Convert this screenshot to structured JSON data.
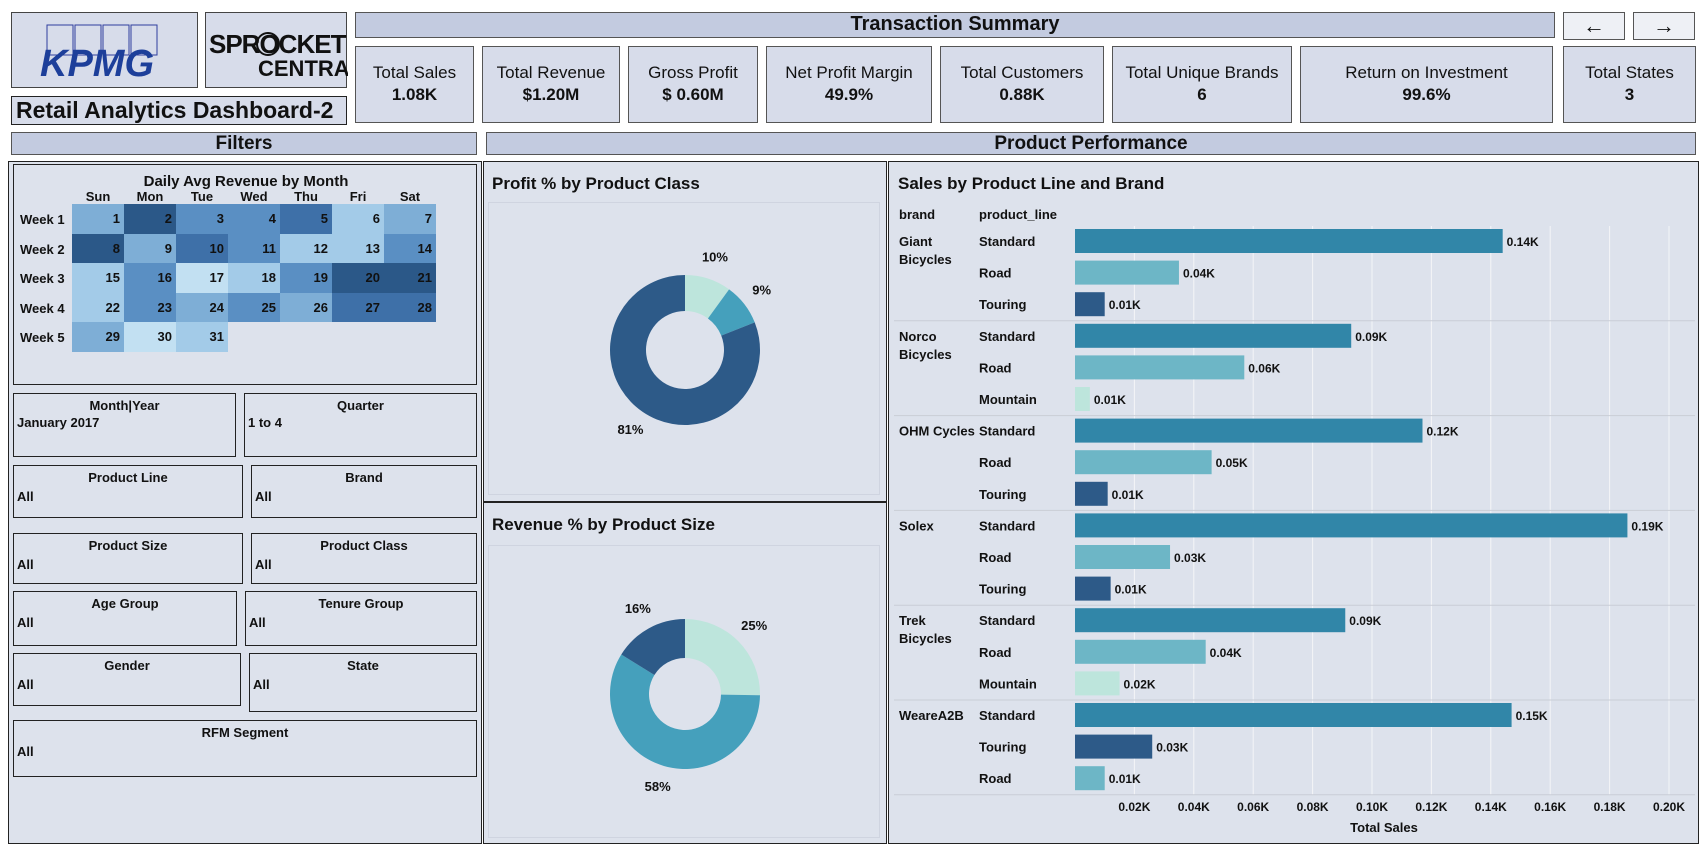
{
  "logos": {
    "kpmg": "KPMG",
    "sprocket_line1": "SPROCKET",
    "sprocket_line2": "CENTRAL"
  },
  "dashboard_title": "Retail Analytics Dashboard-2",
  "transaction_summary_title": "Transaction Summary",
  "nav": {
    "back": "←",
    "forward": "→"
  },
  "kpis": [
    {
      "label": "Total Sales",
      "value": "1.08K"
    },
    {
      "label": "Total Revenue",
      "value": "$1.20M"
    },
    {
      "label": "Gross Profit",
      "value": "$ 0.60M"
    },
    {
      "label": "Net Profit Margin",
      "value": "49.9%"
    },
    {
      "label": "Total Customers",
      "value": "0.88K"
    },
    {
      "label": "Total Unique Brands",
      "value": "6"
    },
    {
      "label": "Return on Investment",
      "value": "99.6%"
    },
    {
      "label": "Total States",
      "value": "3"
    }
  ],
  "filters_header": "Filters",
  "product_performance_header": "Product Performance",
  "calendar": {
    "title": "Daily Avg Revenue by Month",
    "days": [
      "Sun",
      "Mon",
      "Tue",
      "Wed",
      "Thu",
      "Fri",
      "Sat"
    ],
    "weeks": [
      "Week 1",
      "Week 2",
      "Week 3",
      "Week 4",
      "Week 5"
    ],
    "cells": [
      [
        "1",
        "2",
        "3",
        "4",
        "5",
        "6",
        "7"
      ],
      [
        "8",
        "9",
        "10",
        "11",
        "12",
        "13",
        "14"
      ],
      [
        "15",
        "16",
        "17",
        "18",
        "19",
        "20",
        "21"
      ],
      [
        "22",
        "23",
        "24",
        "25",
        "26",
        "27",
        "28"
      ],
      [
        "29",
        "30",
        "31",
        "",
        "",
        "",
        ""
      ]
    ],
    "intensity": [
      [
        2,
        5,
        3,
        3,
        4,
        1,
        2
      ],
      [
        5,
        2,
        4,
        3,
        1,
        1,
        3
      ],
      [
        1,
        3,
        0,
        1,
        3,
        5,
        5
      ],
      [
        1,
        3,
        2,
        3,
        2,
        4,
        4
      ],
      [
        2,
        0,
        1,
        null,
        null,
        null,
        null
      ]
    ],
    "palette": [
      "#c2e0f2",
      "#a3cbe8",
      "#7eaed6",
      "#5a8fc3",
      "#3e70a8",
      "#2b5888"
    ]
  },
  "filters": {
    "month_year": {
      "label": "Month|Year",
      "value": "January 2017"
    },
    "quarter": {
      "label": "Quarter",
      "value": "1 to 4"
    },
    "product_line": {
      "label": "Product Line",
      "value": "All"
    },
    "brand": {
      "label": "Brand",
      "value": "All"
    },
    "product_size": {
      "label": "Product Size",
      "value": "All"
    },
    "product_class": {
      "label": "Product Class",
      "value": "All"
    },
    "age_group": {
      "label": "Age Group",
      "value": "All"
    },
    "tenure_group": {
      "label": "Tenure Group",
      "value": "All"
    },
    "gender": {
      "label": "Gender",
      "value": "All"
    },
    "state": {
      "label": "State",
      "value": "All"
    },
    "rfm_segment": {
      "label": "RFM Segment",
      "value": "All"
    }
  },
  "chart_data": [
    {
      "type": "pie",
      "title": "Profit % by Product Class",
      "slices": [
        {
          "value": 10,
          "label": "10%",
          "color": "#bde5dc"
        },
        {
          "value": 9,
          "label": "9%",
          "color": "#45a0bc"
        },
        {
          "value": 81,
          "label": "81%",
          "color": "#2d5a88"
        }
      ],
      "donut": true
    },
    {
      "type": "pie",
      "title": "Revenue % by Product Size",
      "slices": [
        {
          "value": 25,
          "label": "25%",
          "color": "#bde5dc"
        },
        {
          "value": 58,
          "label": "58%",
          "color": "#45a0bc"
        },
        {
          "value": 16,
          "label": "16%",
          "color": "#2d5a88"
        }
      ],
      "donut": true
    },
    {
      "type": "bar",
      "orientation": "horizontal",
      "title": "Sales by Product Line and Brand",
      "column_headers": [
        "brand",
        "product_line"
      ],
      "xlabel": "Total Sales",
      "xlim": [
        0,
        0.2
      ],
      "x_ticks": [
        "0.02K",
        "0.04K",
        "0.06K",
        "0.08K",
        "0.10K",
        "0.12K",
        "0.14K",
        "0.16K",
        "0.18K",
        "0.20K"
      ],
      "groups": [
        {
          "brand": [
            "Giant",
            "Bicycles"
          ],
          "rows": [
            {
              "line": "Standard",
              "value": 0.144,
              "label": "0.14K"
            },
            {
              "line": "Road",
              "value": 0.035,
              "label": "0.04K"
            },
            {
              "line": "Touring",
              "value": 0.01,
              "label": "0.01K"
            }
          ]
        },
        {
          "brand": [
            "Norco",
            "Bicycles"
          ],
          "rows": [
            {
              "line": "Standard",
              "value": 0.093,
              "label": "0.09K"
            },
            {
              "line": "Road",
              "value": 0.057,
              "label": "0.06K"
            },
            {
              "line": "Mountain",
              "value": 0.005,
              "label": "0.01K"
            }
          ]
        },
        {
          "brand": [
            "OHM Cycles"
          ],
          "rows": [
            {
              "line": "Standard",
              "value": 0.117,
              "label": "0.12K"
            },
            {
              "line": "Road",
              "value": 0.046,
              "label": "0.05K"
            },
            {
              "line": "Touring",
              "value": 0.011,
              "label": "0.01K"
            }
          ]
        },
        {
          "brand": [
            "Solex"
          ],
          "rows": [
            {
              "line": "Standard",
              "value": 0.186,
              "label": "0.19K"
            },
            {
              "line": "Road",
              "value": 0.032,
              "label": "0.03K"
            },
            {
              "line": "Touring",
              "value": 0.012,
              "label": "0.01K"
            }
          ]
        },
        {
          "brand": [
            "Trek",
            "Bicycles"
          ],
          "rows": [
            {
              "line": "Standard",
              "value": 0.091,
              "label": "0.09K"
            },
            {
              "line": "Road",
              "value": 0.044,
              "label": "0.04K"
            },
            {
              "line": "Mountain",
              "value": 0.015,
              "label": "0.02K"
            }
          ]
        },
        {
          "brand": [
            "WeareA2B"
          ],
          "rows": [
            {
              "line": "Standard",
              "value": 0.147,
              "label": "0.15K"
            },
            {
              "line": "Touring",
              "value": 0.026,
              "label": "0.03K"
            },
            {
              "line": "Road",
              "value": 0.01,
              "label": "0.01K"
            }
          ]
        }
      ],
      "colors": {
        "Standard": "#3186a8",
        "Road": "#6db6c6",
        "Touring": "#2d5a88",
        "Mountain": "#bde5dc"
      }
    }
  ]
}
